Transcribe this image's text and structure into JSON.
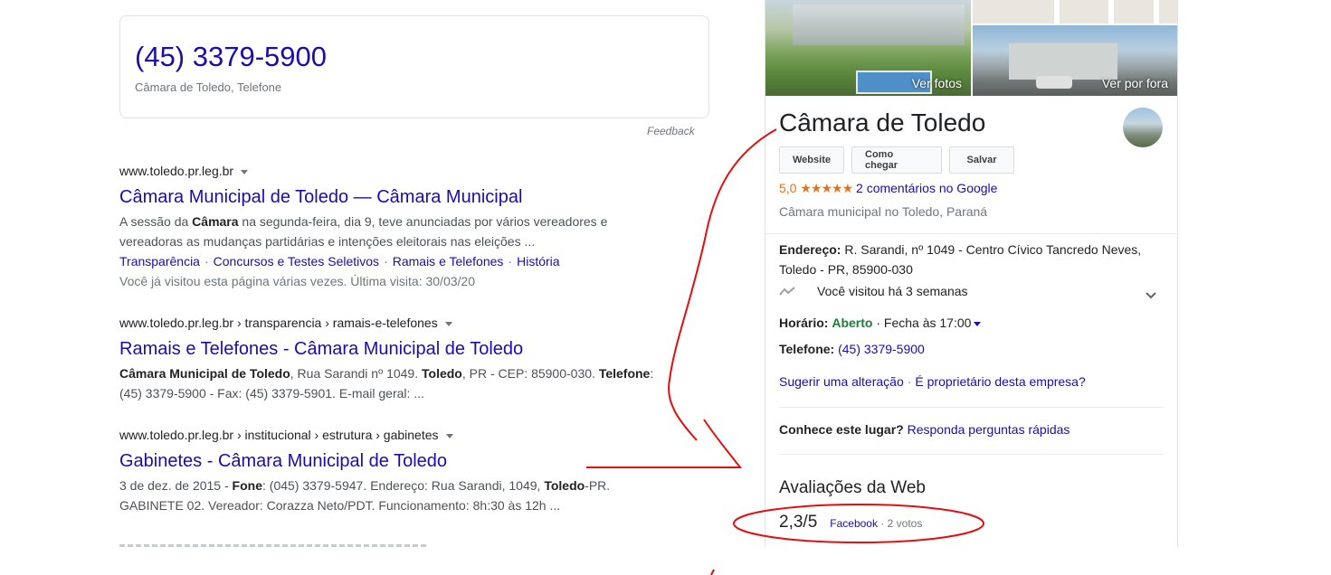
{
  "answer": {
    "phone": "(45) 3379-5900",
    "subtitle": "Câmara de Toledo, Telefone",
    "feedback": "Feedback"
  },
  "results": [
    {
      "url": "www.toledo.pr.leg.br",
      "title": "Câmara Municipal de Toledo — Câmara Municipal",
      "snippet_line1": [
        "A sessão da ",
        "Câmara",
        " na segunda-feira, dia 9, teve anunciadas por vários vereadores e"
      ],
      "snippet_line2": "vereadoras as mudanças partidárias e intenções eleitorais nas eleições ...",
      "sitelinks": [
        "Transparência",
        "Concursos e Testes Seletivos",
        "Ramais e Telefones",
        "História"
      ],
      "visited": "Você já visitou esta página várias vezes. Última visita: 30/03/20"
    },
    {
      "url": "www.toledo.pr.leg.br › transparencia › ramais-e-telefones",
      "title": "Ramais e Telefones - Câmara Municipal de Toledo",
      "snippet_line1": [
        "Câmara Municipal de Toledo",
        ", Rua Sarandi nº 1049. ",
        "Toledo",
        ", PR - CEP: 85900-030. ",
        "Telefone",
        ":"
      ],
      "snippet_line2": "(45) 3379-5900 - Fax: (45) 3379-5901. E-mail geral: ..."
    },
    {
      "url": "www.toledo.pr.leg.br › institucional › estrutura › gabinetes",
      "title": "Gabinetes - Câmara Municipal de Toledo",
      "snippet_line1": [
        "3 de dez. de 2015 - ",
        "Fone",
        ": (045) 3379-5947. Endereço: Rua Sarandi, 1049, ",
        "Toledo",
        "-PR."
      ],
      "snippet_line2": "GABINETE 02. Vereador: Corazza Neto/PDT. Funcionamento: 8h:30 às 12h ..."
    }
  ],
  "panel": {
    "photo_labels": [
      "Ver fotos",
      "Ver por fora"
    ],
    "title": "Câmara de Toledo",
    "buttons": [
      "Website",
      "Como chegar",
      "Salvar"
    ],
    "rating_value": "5,0",
    "rating_stars": "★★★★★",
    "reviews_link": "2 comentários no Google",
    "type": "Câmara municipal no Toledo, Paraná",
    "address_label": "Endereço:",
    "address_line1": "R. Sarandi, nº 1049 - Centro Cívico Tancredo Neves,",
    "address_line2": "Toledo - PR, 85900-030",
    "visited": "Você visitou há 3 semanas",
    "hours_label": "Horário:",
    "hours_status": "Aberto",
    "hours_sep": " · ",
    "hours_close": "Fecha às 17:00",
    "phone_label": "Telefone:",
    "phone": "(45) 3379-5900",
    "suggest": "Sugerir uma alteração",
    "owner": "É proprietário desta empresa?",
    "question_label": "Conhece este lugar?",
    "question_link": "Responda perguntas rápidas",
    "reviews_title": "Avaliações da Web",
    "web_score": "2,3/5",
    "web_source": "Facebook",
    "web_votes": " · 2 votos"
  },
  "colors": {
    "link": "#1a0dab",
    "annotation_red": "#e01010",
    "open_green": "#188038",
    "star_orange": "#e7711b"
  }
}
